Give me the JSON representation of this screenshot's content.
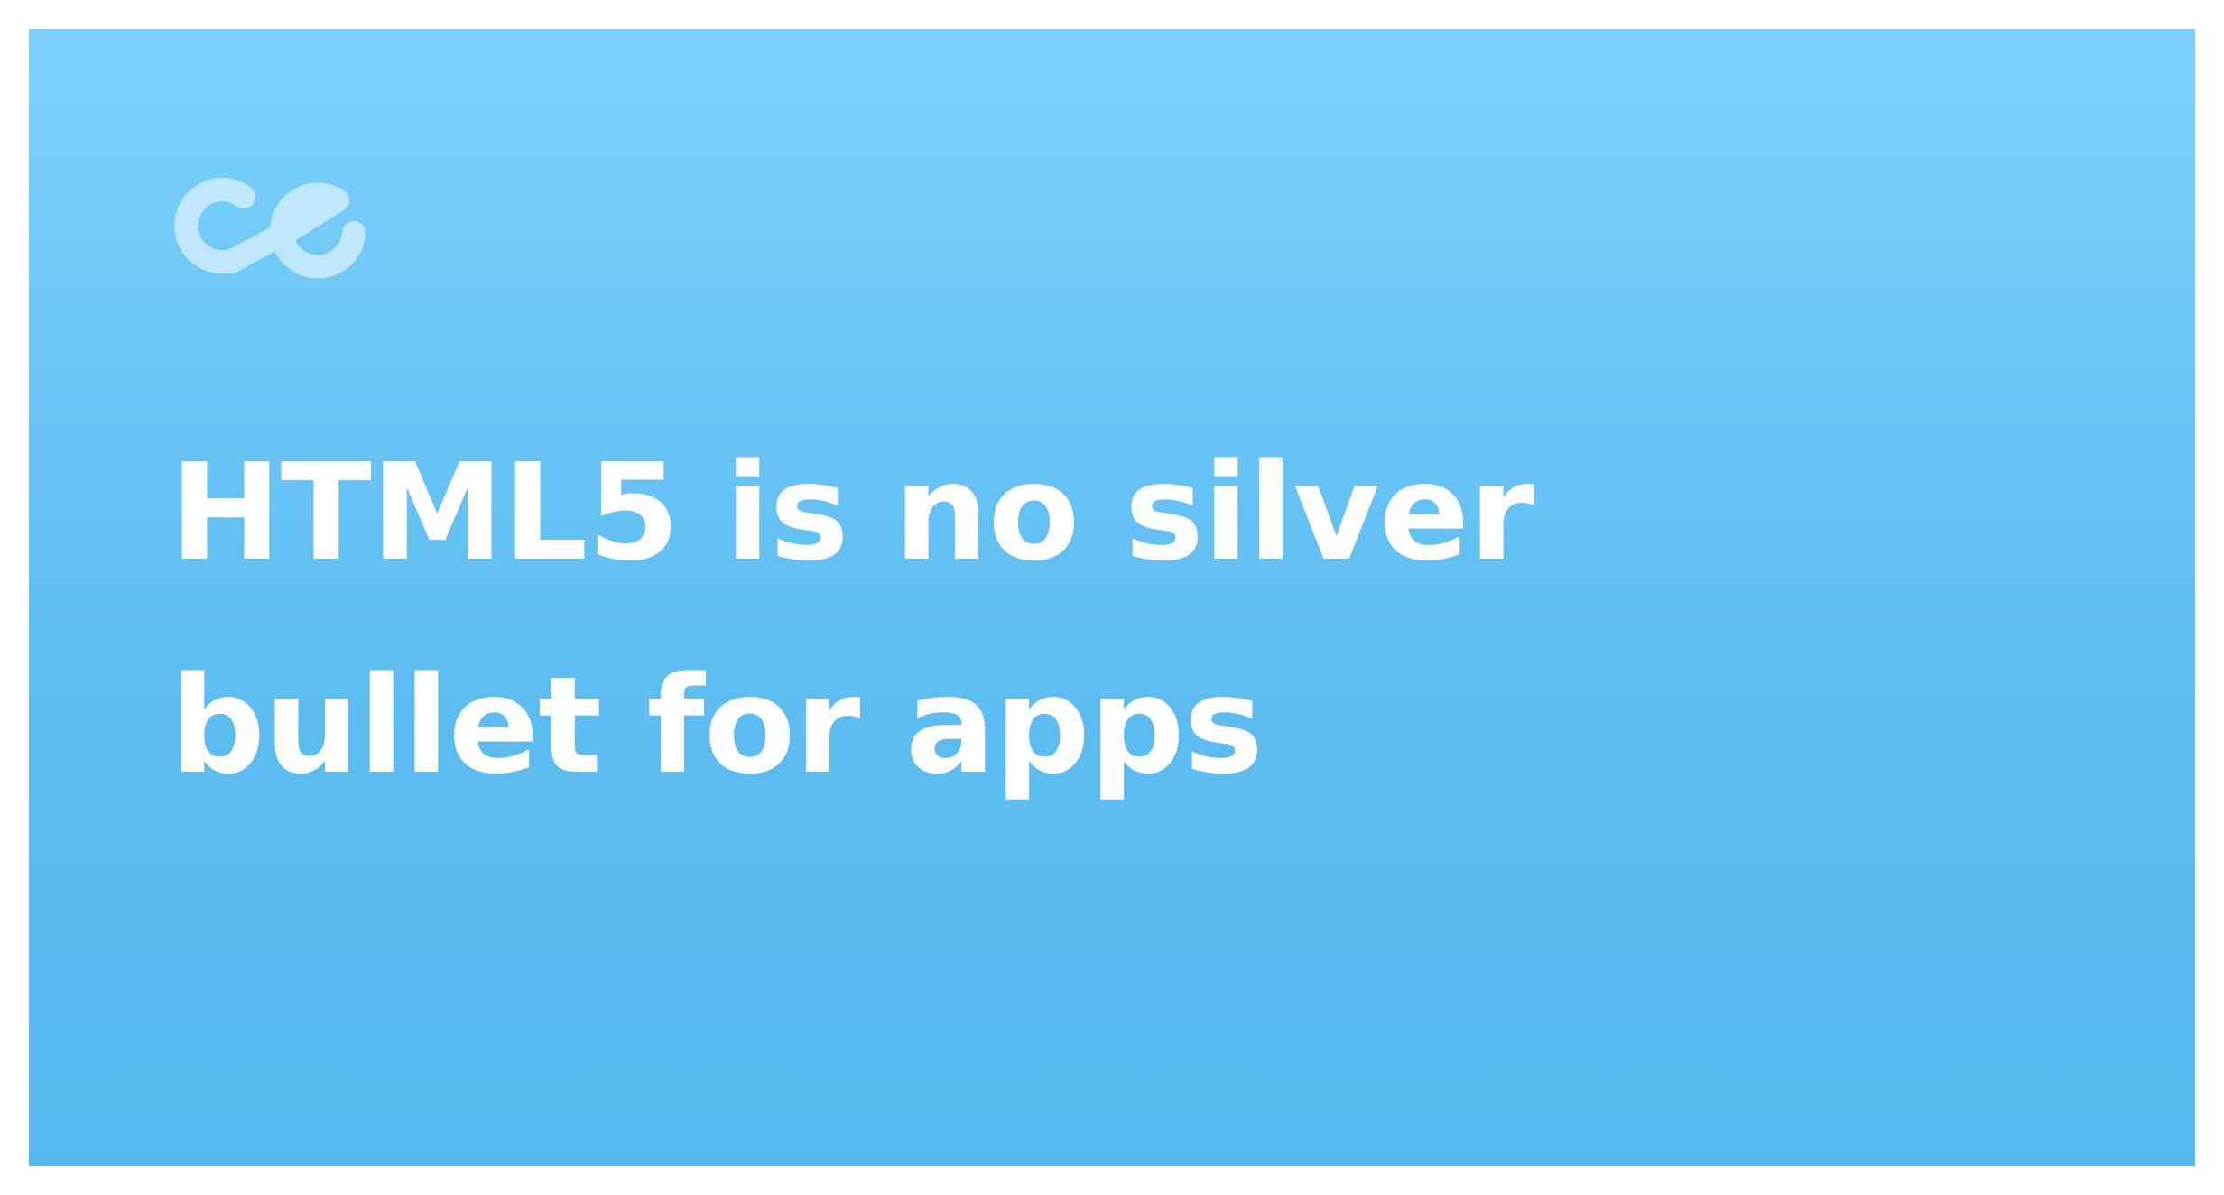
{
  "brand": {
    "logo_icon": "ce-monogram-icon",
    "logo_color": "#bfe7fd"
  },
  "headline": {
    "text": "HTML5 is no silver bullet for apps"
  },
  "colors": {
    "card_top": "#7dd2fd",
    "card_bottom": "#55b9ef",
    "text": "#ffffff",
    "frame": "#ffffff"
  }
}
